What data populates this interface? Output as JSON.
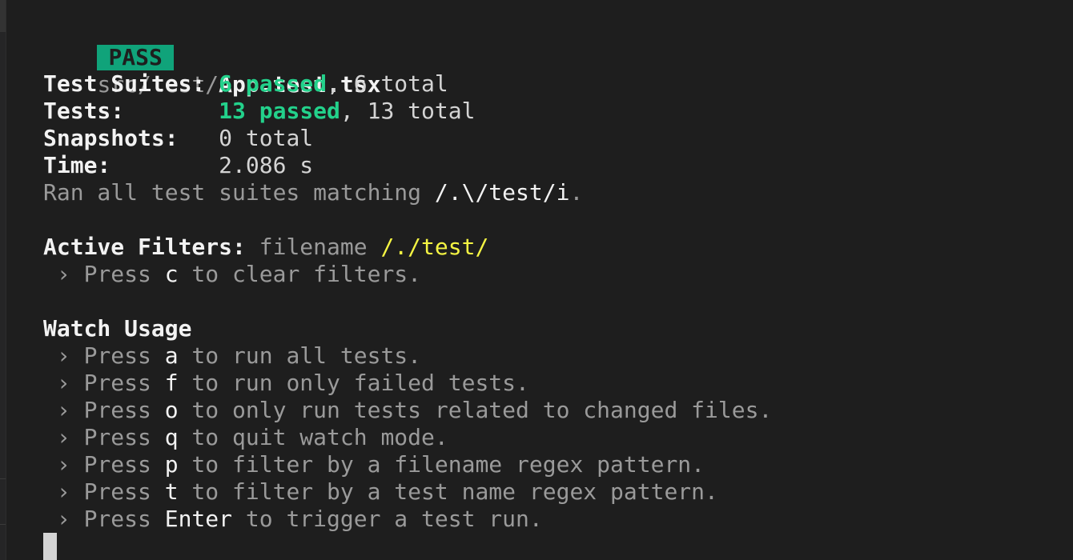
{
  "header": {
    "badge": "PASS",
    "path_dir": "src/test/",
    "path_file": "App.test.tsx"
  },
  "summary": {
    "suites_label": "Test Suites:",
    "suites_passed": "6 passed",
    "suites_total": ", 6 total",
    "tests_label": "Tests:",
    "tests_passed": "13 passed",
    "tests_total": ", 13 total",
    "snapshots_label": "Snapshots:",
    "snapshots_value": "0 total",
    "time_label": "Time:",
    "time_value": "2.086 s",
    "ran_text": "Ran all test suites matching ",
    "ran_pattern": "/.\\/test/i",
    "ran_end": "."
  },
  "filters": {
    "label": "Active Filters:",
    "type": " filename ",
    "pattern": "/./test/",
    "hint_prefix": " › Press ",
    "hint_key": "c",
    "hint_suffix": " to clear filters."
  },
  "watch": {
    "title": "Watch Usage",
    "items": [
      {
        "prefix": " › Press ",
        "key": "a",
        "text": " to run all tests."
      },
      {
        "prefix": " › Press ",
        "key": "f",
        "text": " to run only failed tests."
      },
      {
        "prefix": " › Press ",
        "key": "o",
        "text": " to only run tests related to changed files."
      },
      {
        "prefix": " › Press ",
        "key": "q",
        "text": " to quit watch mode."
      },
      {
        "prefix": " › Press ",
        "key": "p",
        "text": " to filter by a filename regex pattern."
      },
      {
        "prefix": " › Press ",
        "key": "t",
        "text": " to filter by a test name regex pattern."
      },
      {
        "prefix": " › Press ",
        "key": "Enter",
        "text": " to trigger a test run."
      }
    ]
  },
  "colors": {
    "background": "#1e1e1e",
    "pass_badge": "#10a37a",
    "passed_text": "#23d18b",
    "pattern_text": "#f5f543",
    "dim_text": "#9a9a9a"
  }
}
